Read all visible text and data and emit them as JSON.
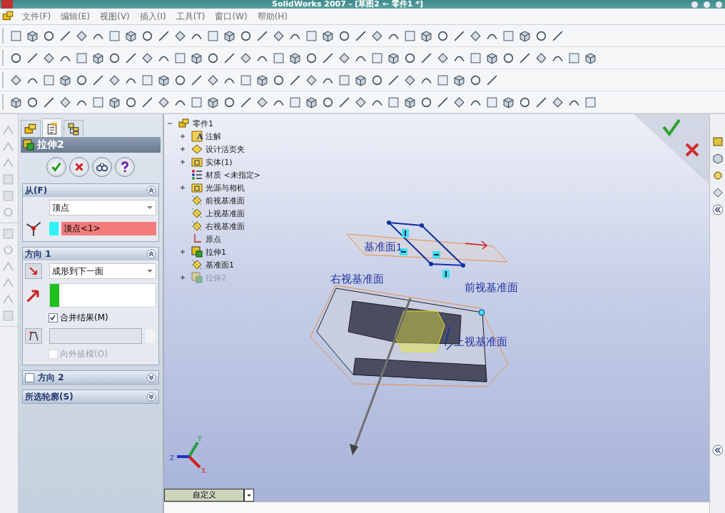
{
  "window": {
    "title": "SolidWorks 2007 - [草图2 ← 零件1 *]"
  },
  "menu": [
    "文件(F)",
    "编辑(E)",
    "视图(V)",
    "插入(I)",
    "工具(T)",
    "窗口(W)",
    "帮助(H)"
  ],
  "property_manager": {
    "tabs": [
      {
        "kind": "tree",
        "selected": false
      },
      {
        "kind": "properties",
        "selected": true
      },
      {
        "kind": "config",
        "selected": false
      }
    ],
    "title": "拉伸2",
    "sections": [
      {
        "kind": "from",
        "title": "从(F)",
        "expanded": true,
        "select": "顶点",
        "selection": "顶点<1>"
      },
      {
        "kind": "direction",
        "title": "方向 1",
        "expanded": true,
        "select": "成形到下一面",
        "merge": {
          "label": "合并结果(M)",
          "checked": true
        },
        "draft": {
          "label": "向外拔模(O)",
          "disabled": true
        }
      },
      {
        "kind": "toggle",
        "title": "方向 2",
        "expanded": false,
        "checked": false
      },
      {
        "kind": "plain",
        "title": "所选轮廓(S)",
        "expanded": false
      }
    ]
  },
  "tree": {
    "label": "零件1",
    "expanded": true,
    "children": [
      {
        "kind": "annotation",
        "glyph": "A",
        "label": "注解",
        "collapsed": true,
        "disabled": false
      },
      {
        "kind": "design",
        "label": "设计活页夹",
        "collapsed": true,
        "disabled": false
      },
      {
        "kind": "body",
        "label": "实体(1)",
        "collapsed": true,
        "disabled": false
      },
      {
        "kind": "material",
        "label": "材质 <未指定>",
        "collapsed": false,
        "disabled": false
      },
      {
        "kind": "lights",
        "label": "光源与相机",
        "collapsed": true,
        "disabled": false
      },
      {
        "kind": "plane",
        "label": "前视基准面",
        "collapsed": false,
        "disabled": false
      },
      {
        "kind": "plane",
        "label": "上视基准面",
        "collapsed": false,
        "disabled": false
      },
      {
        "kind": "plane",
        "label": "右视基准面",
        "collapsed": false,
        "disabled": false
      },
      {
        "kind": "origin",
        "label": "原点",
        "collapsed": false,
        "disabled": false
      },
      {
        "kind": "extrude",
        "label": "拉伸1",
        "collapsed": true,
        "disabled": false
      },
      {
        "kind": "plane",
        "label": "基准面1",
        "collapsed": false,
        "disabled": false
      },
      {
        "kind": "extrude",
        "label": "拉伸2",
        "collapsed": true,
        "disabled": true
      }
    ]
  },
  "viewport": {
    "plane_labels": [
      "基准面1",
      "右视基准面",
      "前视基准面",
      "上视基准面"
    ],
    "axes": [
      "X",
      "Y",
      "Z"
    ]
  },
  "bottom_tab": "自定义"
}
